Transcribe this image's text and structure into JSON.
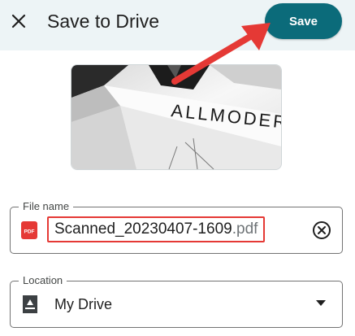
{
  "header": {
    "title": "Save to Drive",
    "close_icon": "close-icon",
    "save_label": "Save"
  },
  "thumbnail": {
    "text": "ALLMODERN",
    "icon": "document-preview"
  },
  "file_name": {
    "label": "File name",
    "base": "Scanned_20230407-1609",
    "extension": ".pdf",
    "type_icon": "pdf-icon",
    "clear_icon": "clear-circle-icon",
    "type_text": "PDF"
  },
  "location": {
    "label": "Location",
    "value": "My Drive",
    "icon": "drive-icon",
    "dropdown_icon": "dropdown-triangle-icon"
  },
  "colors": {
    "header_bg": "#edf4f6",
    "save_button": "#0b6b7a",
    "highlight": "#e53935",
    "pdf_red": "#e53935"
  }
}
